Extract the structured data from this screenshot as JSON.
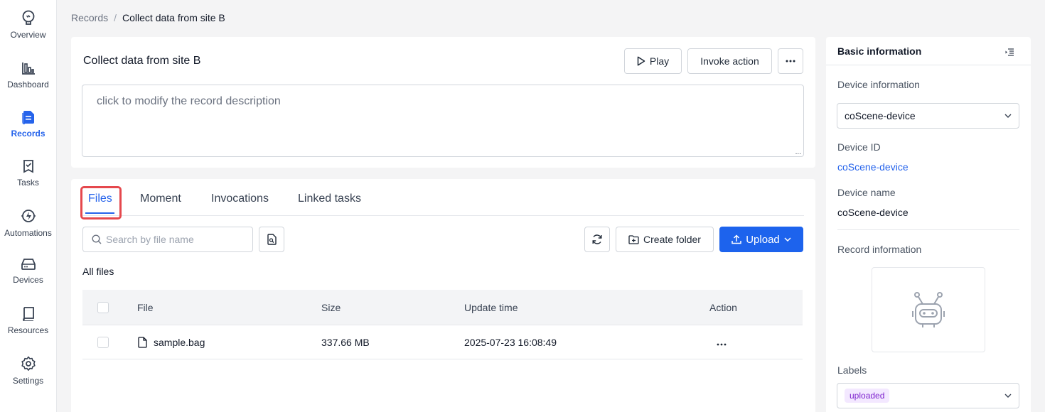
{
  "nav": {
    "items": [
      {
        "label": "Overview",
        "icon": "overview-icon"
      },
      {
        "label": "Dashboard",
        "icon": "bar-chart-icon"
      },
      {
        "label": "Records",
        "icon": "records-icon",
        "active": true
      },
      {
        "label": "Tasks",
        "icon": "tasks-icon"
      },
      {
        "label": "Automations",
        "icon": "automation-icon"
      },
      {
        "label": "Devices",
        "icon": "device-icon"
      },
      {
        "label": "Resources",
        "icon": "book-icon"
      },
      {
        "label": "Settings",
        "icon": "gear-icon"
      }
    ],
    "active_color": "#2563eb"
  },
  "breadcrumb": {
    "parent": "Records",
    "separator": "/",
    "current": "Collect data from site B"
  },
  "record": {
    "title": "Collect data from site B",
    "play_label": "Play",
    "invoke_label": "Invoke action",
    "description_placeholder": "click to modify the record description"
  },
  "tabs": [
    {
      "label": "Files",
      "active": true
    },
    {
      "label": "Moment"
    },
    {
      "label": "Invocations"
    },
    {
      "label": "Linked tasks"
    }
  ],
  "files": {
    "search_placeholder": "Search by file name",
    "create_folder_label": "Create folder",
    "upload_label": "Upload",
    "all_files_label": "All files",
    "columns": [
      "File",
      "Size",
      "Update time",
      "Action"
    ],
    "rows": [
      {
        "name": "sample.bag",
        "size": "337.66 MB",
        "updated": "2025-07-23 16:08:49"
      }
    ]
  },
  "panel": {
    "title": "Basic information",
    "device_info_label": "Device information",
    "device_select": "coScene-device",
    "device_id_label": "Device ID",
    "device_id": "coScene-device",
    "device_name_label": "Device name",
    "device_name": "coScene-device",
    "record_info_label": "Record information",
    "labels_label": "Labels",
    "label_tag": "uploaded"
  },
  "colors": {
    "primary": "#2563eb",
    "highlight": "#e5484d",
    "tag_bg": "#f3e8ff",
    "tag_text": "#7e22ce"
  }
}
